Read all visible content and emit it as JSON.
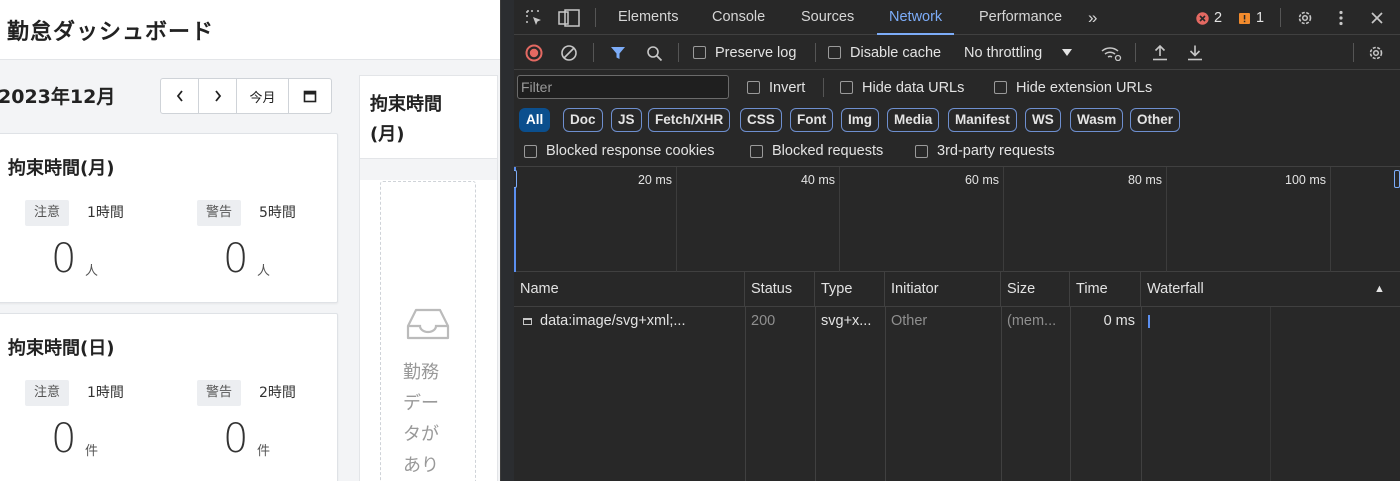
{
  "app": {
    "title": "勤怠ダッシュボード",
    "month_label": "2023年12月",
    "nav": {
      "prev": "‹",
      "next": "›",
      "current_month": "今月",
      "calendar_icon": "calendar-icon"
    },
    "cards": [
      {
        "title": "拘束時間(月)",
        "metrics": [
          {
            "badge": "注意",
            "threshold": "1時間",
            "value": "0",
            "unit": "人"
          },
          {
            "badge": "警告",
            "threshold": "5時間",
            "value": "0",
            "unit": "人"
          }
        ]
      },
      {
        "title": "拘束時間(日)",
        "metrics": [
          {
            "badge": "注意",
            "threshold": "1時間",
            "value": "0",
            "unit": "件"
          },
          {
            "badge": "警告",
            "threshold": "2時間",
            "value": "0",
            "unit": "件"
          }
        ]
      }
    ],
    "side_panel": {
      "title": "拘束時間(月)",
      "empty_icon": "inbox-icon",
      "empty_text": "勤務データがあり"
    }
  },
  "devtools": {
    "tabs": [
      "Elements",
      "Console",
      "Sources",
      "Network",
      "Performance"
    ],
    "active_tab": "Network",
    "more_tabs": "»",
    "error_count": "2",
    "warning_count": "1",
    "toolbar": {
      "preserve_log": "Preserve log",
      "disable_cache": "Disable cache",
      "throttling": "No throttling"
    },
    "filter": {
      "placeholder": "Filter",
      "invert": "Invert",
      "hide_data_urls": "Hide data URLs",
      "hide_extension_urls": "Hide extension URLs"
    },
    "types": [
      "All",
      "Doc",
      "JS",
      "Fetch/XHR",
      "CSS",
      "Font",
      "Img",
      "Media",
      "Manifest",
      "WS",
      "Wasm",
      "Other"
    ],
    "active_type": "All",
    "blocked": {
      "blocked_cookies": "Blocked response cookies",
      "blocked_requests": "Blocked requests",
      "third_party": "3rd-party requests"
    },
    "timeline_ticks": [
      "20 ms",
      "40 ms",
      "60 ms",
      "80 ms",
      "100 ms"
    ],
    "columns": [
      "Name",
      "Status",
      "Type",
      "Initiator",
      "Size",
      "Time",
      "Waterfall"
    ],
    "sort_indicator": "▲",
    "requests": [
      {
        "name": "data:image/svg+xml;...",
        "status": "200",
        "type": "svg+x...",
        "initiator": "Other",
        "size": "(mem...",
        "time": "0 ms"
      }
    ],
    "colors": {
      "accent": "#7cacf8",
      "error": "#e46962",
      "warning": "#f28b2d",
      "record": "#e46962"
    }
  }
}
